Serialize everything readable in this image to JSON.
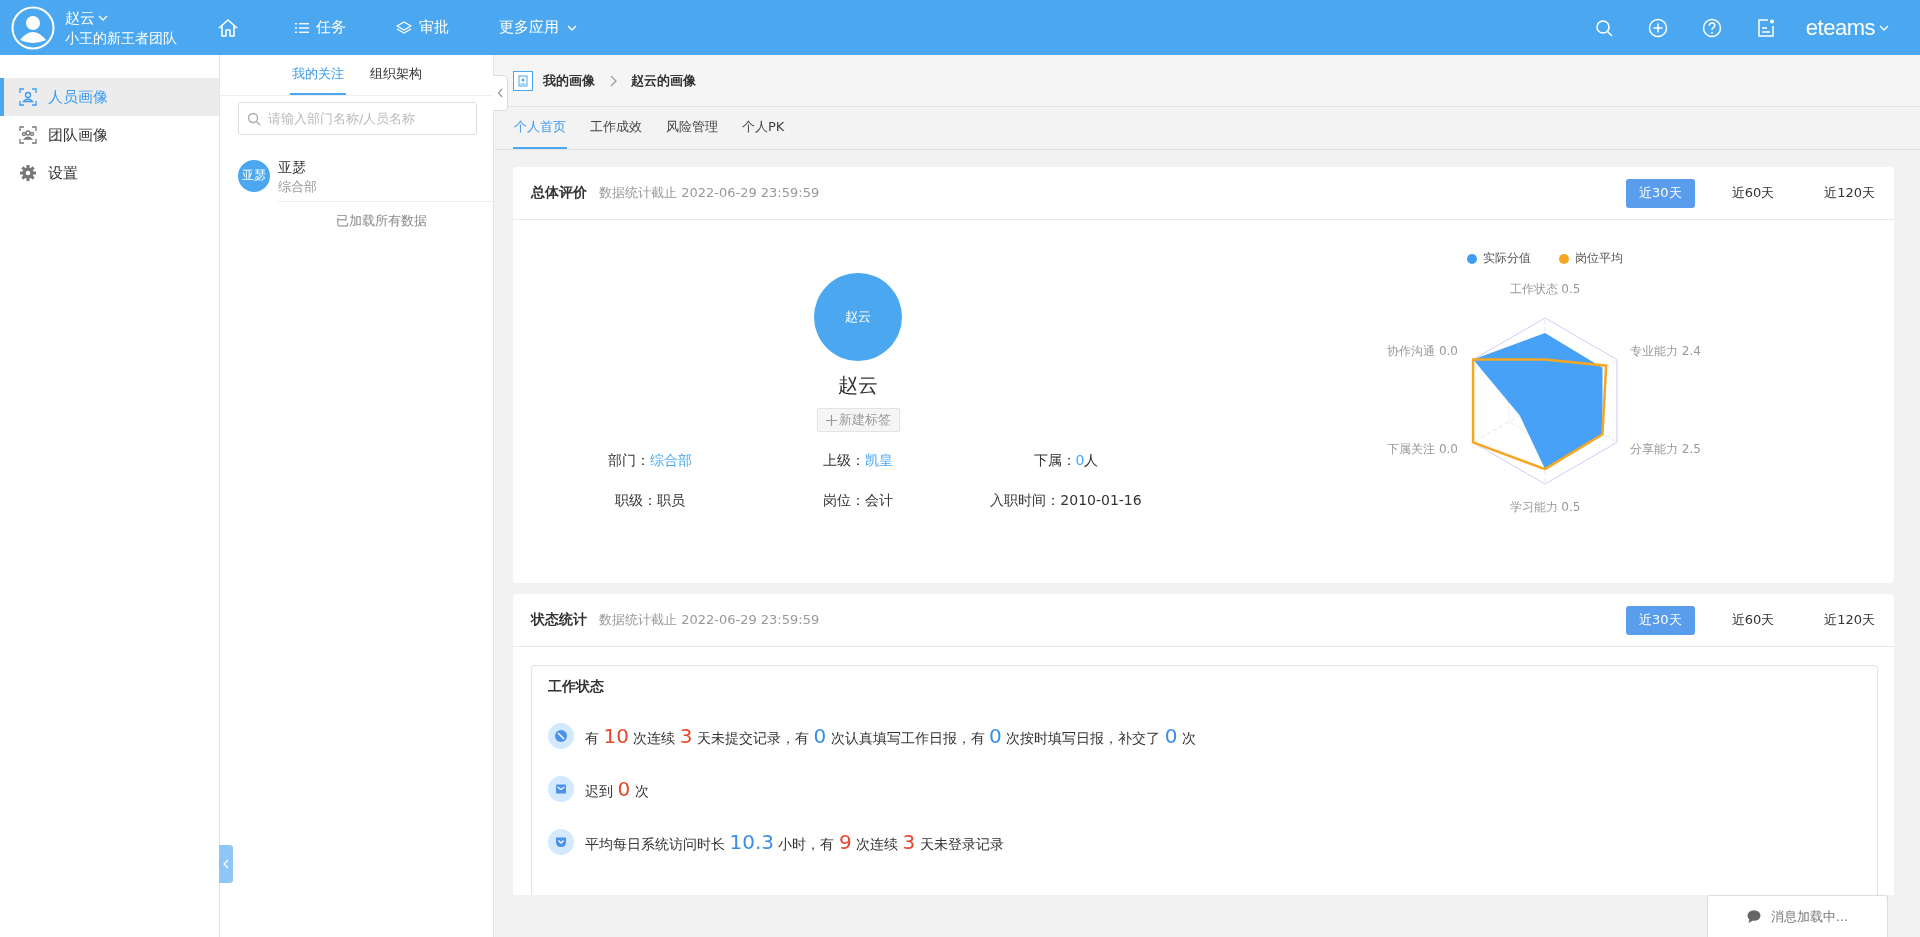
{
  "topbar": {
    "user_name": "赵云",
    "team": "小王的新王者团队",
    "nav": [
      {
        "kind": "home"
      },
      {
        "kind": "list",
        "label": "任务"
      },
      {
        "kind": "layers",
        "label": "审批"
      },
      {
        "kind": "more",
        "label": "更多应用"
      }
    ],
    "tools": [
      {
        "kind": "search"
      },
      {
        "kind": "add"
      },
      {
        "kind": "help"
      },
      {
        "kind": "notes"
      }
    ],
    "logo": "eteams"
  },
  "sidebar": {
    "items": [
      {
        "kind": "person",
        "label": "人员画像",
        "selected": true
      },
      {
        "kind": "team",
        "label": "团队画像",
        "selected": false
      },
      {
        "kind": "gear",
        "label": "设置",
        "selected": false
      }
    ]
  },
  "follow_panel": {
    "tabs": [
      {
        "label": "我的关注",
        "selected": true
      },
      {
        "label": "组织架构",
        "selected": false
      }
    ],
    "search": {
      "placeholder": "请输入部门名称/人员名称"
    },
    "people": [
      {
        "avatar": "亚瑟",
        "name": "亚瑟",
        "department": "综合部"
      }
    ],
    "footer": "已加载所有数据"
  },
  "breadcrumb": [
    "我的画像",
    "赵云的画像"
  ],
  "tabs": [
    {
      "label": "个人首页",
      "selected": true
    },
    {
      "label": "工作成效",
      "selected": false
    },
    {
      "label": "风险管理",
      "selected": false
    },
    {
      "label": "个人PK",
      "selected": false
    }
  ],
  "overview": {
    "title": "总体评价",
    "note": "数据统计截止 2022-06-29 23:59:59",
    "periods": [
      {
        "label": "近30天",
        "selected": true
      },
      {
        "label": "近60天",
        "selected": false
      },
      {
        "label": "近120天",
        "selected": false
      }
    ],
    "profile": {
      "avatar": "赵云",
      "name": "赵云",
      "tag_button": "新建标签",
      "fields": [
        {
          "label": "部门：",
          "value": "综合部",
          "link": true
        },
        {
          "label": "上级：",
          "value": "凯皇",
          "link": true
        },
        {
          "label": "下属：",
          "value": "0",
          "unit": "人",
          "link": true
        },
        {
          "label": "职级：",
          "value": "职员",
          "link": false
        },
        {
          "label": "岗位：",
          "value": "会计",
          "link": false
        },
        {
          "label": "入职时间：",
          "value": "2010-01-16",
          "link": false
        }
      ]
    },
    "radar": {
      "legend": [
        {
          "label": "实际分值",
          "color": "#3d9df7"
        },
        {
          "label": "岗位平均",
          "color": "#f5a623"
        }
      ],
      "axes": [
        "工作状态 0.5",
        "专业能力 2.4",
        "分享能力 2.5",
        "学习能力 0.5",
        "下属关注 0.0",
        "协作沟通 0.0"
      ]
    }
  },
  "status": {
    "title": "状态统计",
    "note": "数据统计截止 2022-06-29 23:59:59",
    "periods": [
      {
        "label": "近30天",
        "selected": true
      },
      {
        "label": "近60天",
        "selected": false
      },
      {
        "label": "近120天",
        "selected": false
      }
    ],
    "section": {
      "title": "工作状态",
      "rows": [
        {
          "kind": "compass",
          "parts": [
            {
              "t": "有 "
            },
            {
              "t": "10",
              "kind": "warn"
            },
            {
              "t": " 次连续 "
            },
            {
              "t": "3",
              "kind": "warn"
            },
            {
              "t": " 天未提交记录，有 "
            },
            {
              "t": "0",
              "kind": "info"
            },
            {
              "t": " 次认真填写工作日报，有 "
            },
            {
              "t": "0",
              "kind": "info"
            },
            {
              "t": " 次按时填写日报，补交了 "
            },
            {
              "t": "0",
              "kind": "info"
            },
            {
              "t": " 次"
            }
          ]
        },
        {
          "kind": "mail",
          "parts": [
            {
              "t": "迟到 "
            },
            {
              "t": "0",
              "kind": "warn"
            },
            {
              "t": " 次"
            }
          ]
        },
        {
          "kind": "pocket",
          "parts": [
            {
              "t": "平均每日系统访问时长 "
            },
            {
              "t": "10.3",
              "kind": "info"
            },
            {
              "t": " 小时，有 "
            },
            {
              "t": "9",
              "kind": "warn"
            },
            {
              "t": " 次连续 "
            },
            {
              "t": "3",
              "kind": "warn"
            },
            {
              "t": " 天未登录记录"
            }
          ]
        }
      ]
    }
  },
  "toast": "消息加载中..."
}
